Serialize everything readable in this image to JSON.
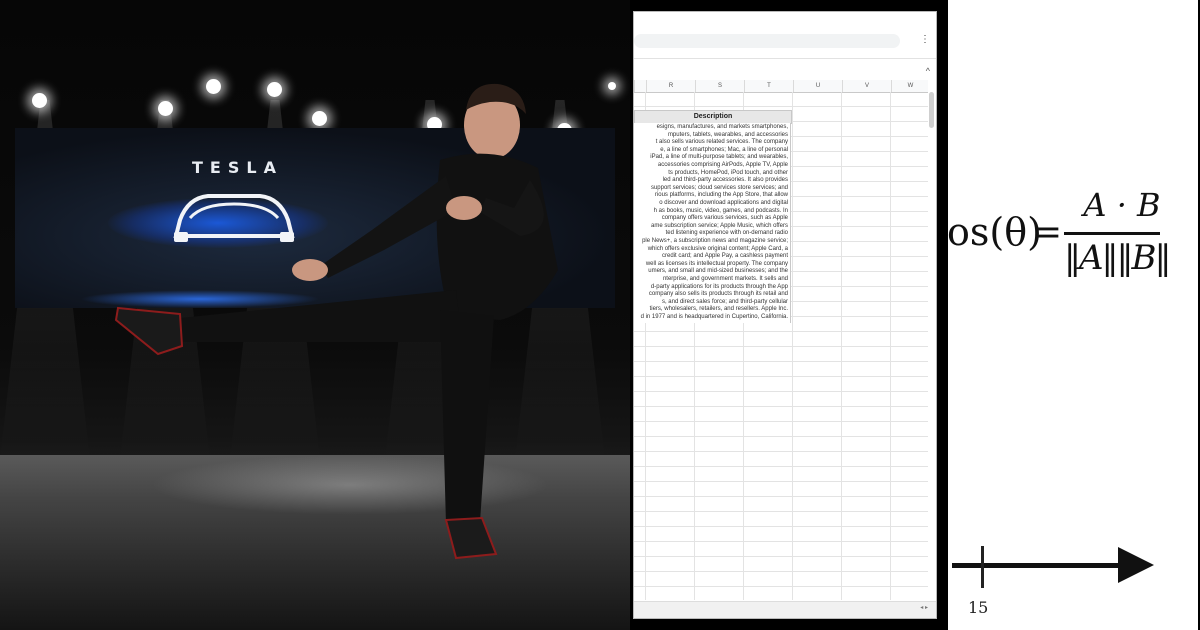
{
  "stage": {
    "brand_text": "TESLA"
  },
  "spreadsheet": {
    "column_letters": [
      "R",
      "S",
      "T",
      "U",
      "V",
      "W"
    ],
    "header": "Description",
    "description_lines": [
      "esigns, manufactures, and markets smartphones,",
      "mputers, tablets, wearables, and accessories",
      "t also sells various related services. The company",
      "e, a line of smartphones; Mac, a line of personal",
      "iPad, a line of multi-purpose tablets; and wearables,",
      "accessories comprising AirPods, Apple TV, Apple",
      "ts products, HomePod, iPod touch, and other",
      "led and third-party accessories. It also provides",
      "support services; cloud services store services; and",
      "rious platforms, including the App Store, that allow",
      "o discover and download applications and digital",
      "h as books, music, video, games, and podcasts. In",
      "company offers various services, such as Apple",
      "ame subscription service; Apple Music, which offers",
      "ted listening experience with on-demand radio",
      "ple News+, a subscription news and magazine service;",
      "which offers exclusive original content; Apple Card, a",
      "credit card; and Apple Pay, a cashless payment",
      "well as licenses its intellectual property. The company",
      "umers, and small and mid-sized businesses; and the",
      "nterprise, and government markets. It sells and",
      "d-party applications for its products through the App",
      "company also sells its products through its retail and",
      "s, and direct sales force; and third-party cellular",
      "tiers, wholesalers, retailers, and resellers. Apple Inc.",
      "d in 1977 and is headquartered in Cupertino, California."
    ],
    "menu_icon": "⋮",
    "collapse_icon": "^"
  },
  "formula": {
    "lhs": "os(θ)",
    "equals": "=",
    "numerator": "A · B",
    "denominator": "‖A‖‖B‖",
    "axis_label": "15"
  }
}
